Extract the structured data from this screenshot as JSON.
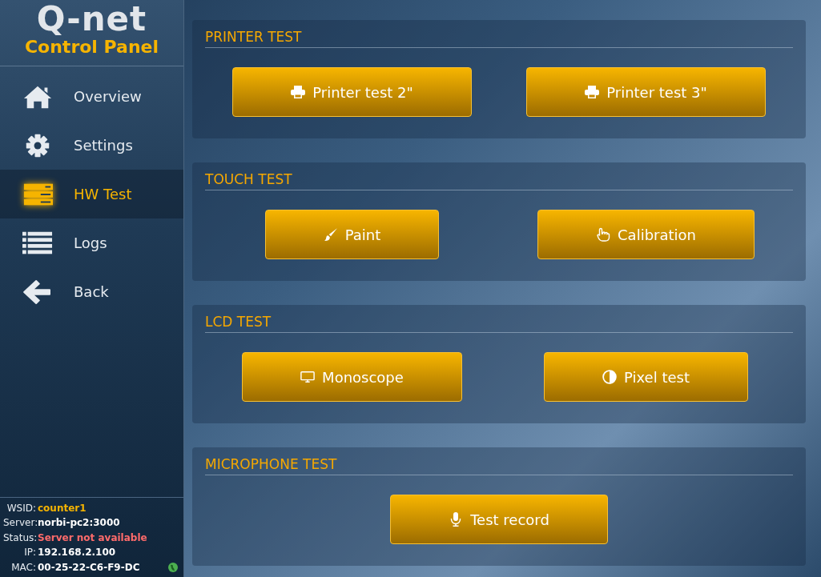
{
  "logo": {
    "brand": "Q-net",
    "subtitle": "Control Panel"
  },
  "nav": [
    {
      "label": "Overview",
      "kind": "home",
      "selected": false
    },
    {
      "label": "Settings",
      "kind": "gear",
      "selected": false
    },
    {
      "label": "HW Test",
      "kind": "server",
      "selected": true
    },
    {
      "label": "Logs",
      "kind": "list",
      "selected": false
    },
    {
      "label": "Back",
      "kind": "back",
      "selected": false
    }
  ],
  "info": [
    {
      "label": "WSID:",
      "value": "counter1",
      "kind": "accent"
    },
    {
      "label": "Server:",
      "value": "norbi-pc2:3000",
      "kind": "plain"
    },
    {
      "label": "Status:",
      "value": "Server not available",
      "kind": "error"
    },
    {
      "label": "IP:",
      "value": "192.168.2.100",
      "kind": "plain"
    },
    {
      "label": "MAC:",
      "value": "00-25-22-C6-F9-DC",
      "kind": "plain"
    }
  ],
  "sections": [
    {
      "title": "PRINTER TEST",
      "buttons": [
        {
          "label": "Printer test 2\"",
          "kind": "printer"
        },
        {
          "label": "Printer test 3\"",
          "kind": "printer"
        }
      ]
    },
    {
      "title": "TOUCH TEST",
      "buttons": [
        {
          "label": "Paint",
          "kind": "brush"
        },
        {
          "label": "Calibration",
          "kind": "hand"
        }
      ]
    },
    {
      "title": "LCD TEST",
      "buttons": [
        {
          "label": "Monoscope",
          "kind": "monitor"
        },
        {
          "label": "Pixel test",
          "kind": "contrast"
        }
      ]
    },
    {
      "title": "MICROPHONE TEST",
      "buttons": [
        {
          "label": "Test record",
          "kind": "mic"
        }
      ]
    }
  ]
}
